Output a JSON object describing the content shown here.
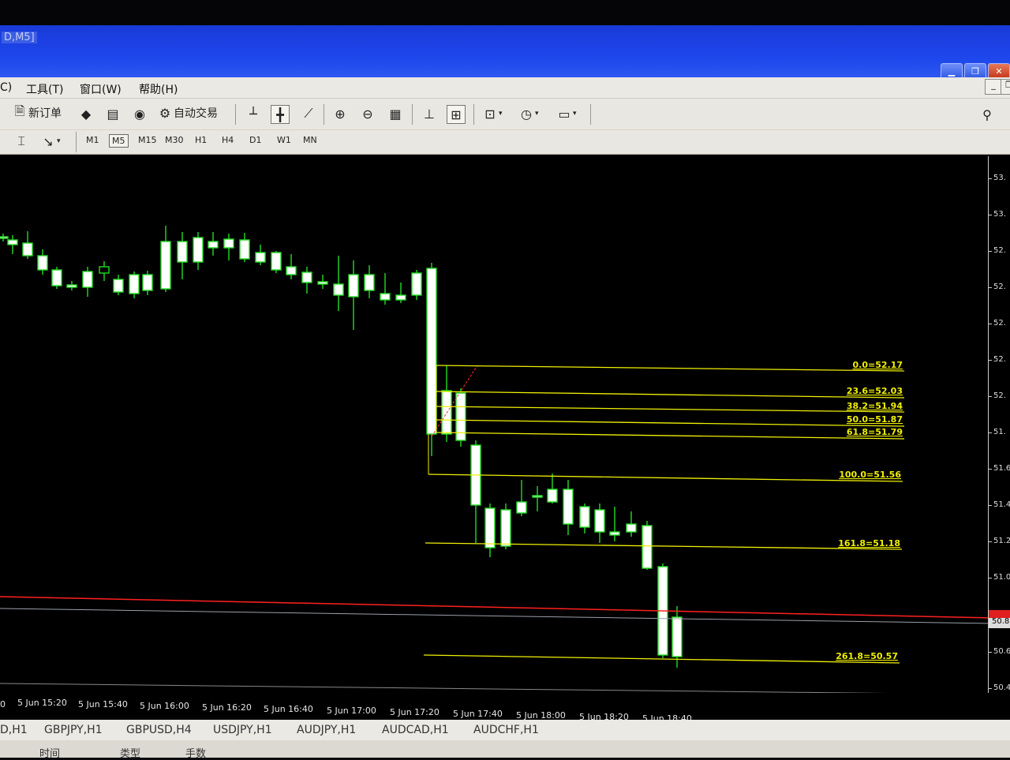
{
  "window": {
    "title": "D,M5]"
  },
  "menu": {
    "items": [
      "C)",
      "工具(T)",
      "窗口(W)",
      "帮助(H)"
    ]
  },
  "toolbar": {
    "new_order": "新订单",
    "auto_trade": "自动交易"
  },
  "timeframes": [
    "M1",
    "M5",
    "M15",
    "M30",
    "H1",
    "H4",
    "D1",
    "W1",
    "MN"
  ],
  "active_timeframe": "M5",
  "price_axis": {
    "labels": [
      "53.",
      "53.",
      "52.",
      "52.",
      "52.",
      "52.",
      "52.",
      "51.",
      "51.6",
      "51.4",
      "51.2",
      "51.0",
      "50.8",
      "50.6",
      "50.4"
    ],
    "current_price_label": "50.8"
  },
  "time_axis": {
    "labels": [
      "0",
      "5 Jun 15:20",
      "5 Jun 15:40",
      "5 Jun 16:00",
      "5 Jun 16:20",
      "5 Jun 16:40",
      "5 Jun 17:00",
      "5 Jun 17:20",
      "5 Jun 17:40",
      "5 Jun 18:00",
      "5 Jun 18:20",
      "5 Jun 18:40"
    ]
  },
  "fibonacci": {
    "levels": [
      {
        "label": "0.0=52.17"
      },
      {
        "label": "23.6=52.03"
      },
      {
        "label": "38.2=51.94"
      },
      {
        "label": "50.0=51.87"
      },
      {
        "label": "61.8=51.79"
      },
      {
        "label": "100.0=51.56"
      },
      {
        "label": "161.8=51.18"
      },
      {
        "label": "261.8=50.57"
      }
    ],
    "color": "#f0f000"
  },
  "colors": {
    "bull_outline": "#22dd22",
    "bear_fill": "#ffffff",
    "red_line": "#ff2020",
    "chart_bg": "#000000"
  },
  "tabs": {
    "items": [
      "D,H1",
      "GBPJPY,H1",
      "GBPUSD,H4",
      "USDJPY,H1",
      "AUDJPY,H1",
      "AUDCAD,H1",
      "AUDCHF,H1"
    ]
  },
  "bottom_panel": {
    "columns": [
      "时间",
      "类型",
      "手数"
    ]
  }
}
